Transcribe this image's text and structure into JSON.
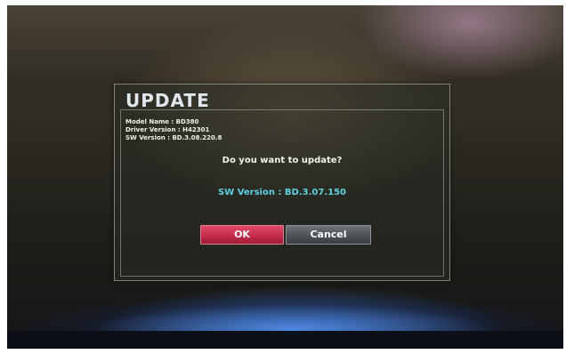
{
  "dialog": {
    "title": "UPDATE",
    "info": {
      "model": "Model Name : BD380",
      "driver": "Driver Version : H42301",
      "sw": "SW Version : BD.3.08.220.8"
    },
    "question": "Do you want to update?",
    "new_version": "SW Version : BD.3.07.150",
    "ok_label": "OK",
    "cancel_label": "Cancel"
  },
  "colors": {
    "ok_button": "#c12a49",
    "cancel_button": "#4a4f52",
    "version_text": "#5fd0e0"
  }
}
